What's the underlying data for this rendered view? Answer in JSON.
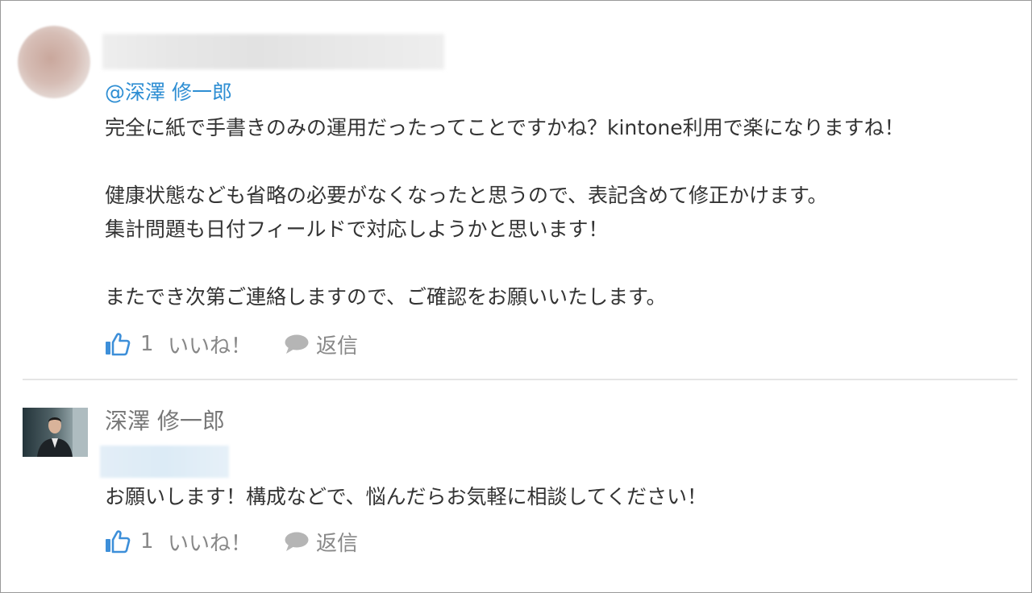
{
  "comments": [
    {
      "mention": "@深澤 修一郎",
      "paragraphs": [
        "完全に紙で手書きのみの運用だったってことですかね？kintone利用で楽になりますね！",
        "健康状態なども省略の必要がなくなったと思うので、表記含めて修正かけます。",
        "集計問題も日付フィールドで対応しようかと思います！",
        "またでき次第ご連絡しますので、ご確認をお願いいたします。"
      ],
      "like_count": "1",
      "like_label": "いいね！",
      "reply_label": "返信",
      "icons": {
        "like": "thumbs-up-icon",
        "reply": "speech-bubble-icon"
      }
    },
    {
      "author": "深澤 修一郎",
      "text": "お願いします！構成などで、悩んだらお気軽に相談してください！",
      "like_count": "1",
      "like_label": "いいね！",
      "reply_label": "返信",
      "icons": {
        "like": "thumbs-up-icon",
        "reply": "speech-bubble-icon"
      }
    }
  ],
  "colors": {
    "mention": "#2e8ed3",
    "like_icon": "#3d8fd9",
    "reply_icon": "#b5b5b5",
    "body_text": "#333333",
    "muted_text": "#888888"
  }
}
